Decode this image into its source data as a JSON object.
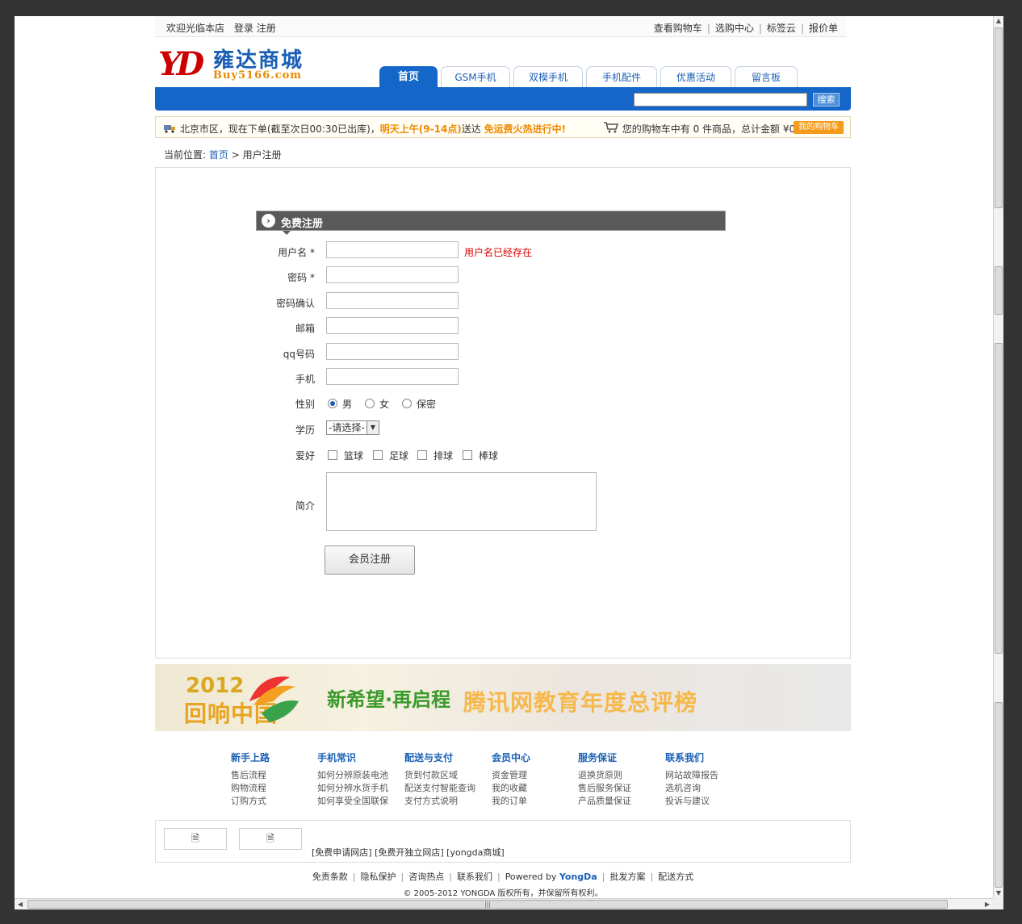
{
  "topbar": {
    "welcome": "欢迎光临本店",
    "login": "登录",
    "register": "注册",
    "right_links": [
      "查看购物车",
      "选购中心",
      "标签云",
      "报价单"
    ]
  },
  "logo": {
    "cn": "雍达商城",
    "en": "Buy5166.com",
    "mark": "YD"
  },
  "nav": {
    "tabs": [
      "首页",
      "GSM手机",
      "双模手机",
      "手机配件",
      "优惠活动",
      "留言板"
    ],
    "search_button": "搜索"
  },
  "infobar": {
    "delivery_1": "北京市区，现在下单(截至次日00:30已出库)，",
    "delivery_highlight": "明天上午(9-14点)",
    "delivery_2": "送达",
    "free_shipping": "免运费火热进行中!",
    "cart_text": "您的购物车中有 0 件商品，总计金额 ¥0.00元。",
    "my_cart": "我的购物车"
  },
  "breadcrumb": {
    "prefix": "当前位置:",
    "home": "首页",
    "arrow": ">",
    "current": "用户注册"
  },
  "form": {
    "title": "免费注册",
    "fields": {
      "username": "用户名 *",
      "password": "密码 *",
      "confirm": "密码确认",
      "email": "邮箱",
      "qq": "qq号码",
      "mobile": "手机",
      "gender": "性别",
      "education": "学历",
      "hobby": "爱好",
      "intro": "简介"
    },
    "username_error": "用户名已经存在",
    "gender_options": [
      "男",
      "女",
      "保密"
    ],
    "gender_selected": "男",
    "education_selected": "-请选择-",
    "hobbies": [
      "篮球",
      "足球",
      "排球",
      "棒球"
    ],
    "submit": "会员注册"
  },
  "banner": {
    "year": "2012",
    "campaign": "回响中国",
    "slogan": "新希望·再启程",
    "title": "腾讯网教育年度总评榜"
  },
  "footer_columns": [
    {
      "heading": "新手上路",
      "items": [
        "售后流程",
        "购物流程",
        "订购方式"
      ]
    },
    {
      "heading": "手机常识",
      "items": [
        "如何分辨原装电池",
        "如何分辨水货手机",
        "如何享受全国联保"
      ]
    },
    {
      "heading": "配送与支付",
      "items": [
        "货到付款区域",
        "配送支付智能查询",
        "支付方式说明"
      ]
    },
    {
      "heading": "会员中心",
      "items": [
        "资金管理",
        "我的收藏",
        "我的订单"
      ]
    },
    {
      "heading": "服务保证",
      "items": [
        "退换货原则",
        "售后服务保证",
        "产品质量保证"
      ]
    },
    {
      "heading": "联系我们",
      "items": [
        "网站故障报告",
        "选机咨询",
        "投诉与建议"
      ]
    }
  ],
  "friend_links": {
    "text": "[免费申请网店] [免费开独立网店] [yongda商城]"
  },
  "footer": {
    "links": [
      "免责条款",
      "隐私保护",
      "咨询热点",
      "联系我们"
    ],
    "powered_prefix": "Powered by",
    "powered_brand": "YongDa",
    "links2": [
      "批发方案",
      "配送方式"
    ],
    "copyright": "© 2005-2012 YONGDA 版权所有，并保留所有权利。"
  },
  "colors": {
    "brand_blue": "#1467c8",
    "accent_orange": "#f08a00",
    "error_red": "#dd0000"
  }
}
